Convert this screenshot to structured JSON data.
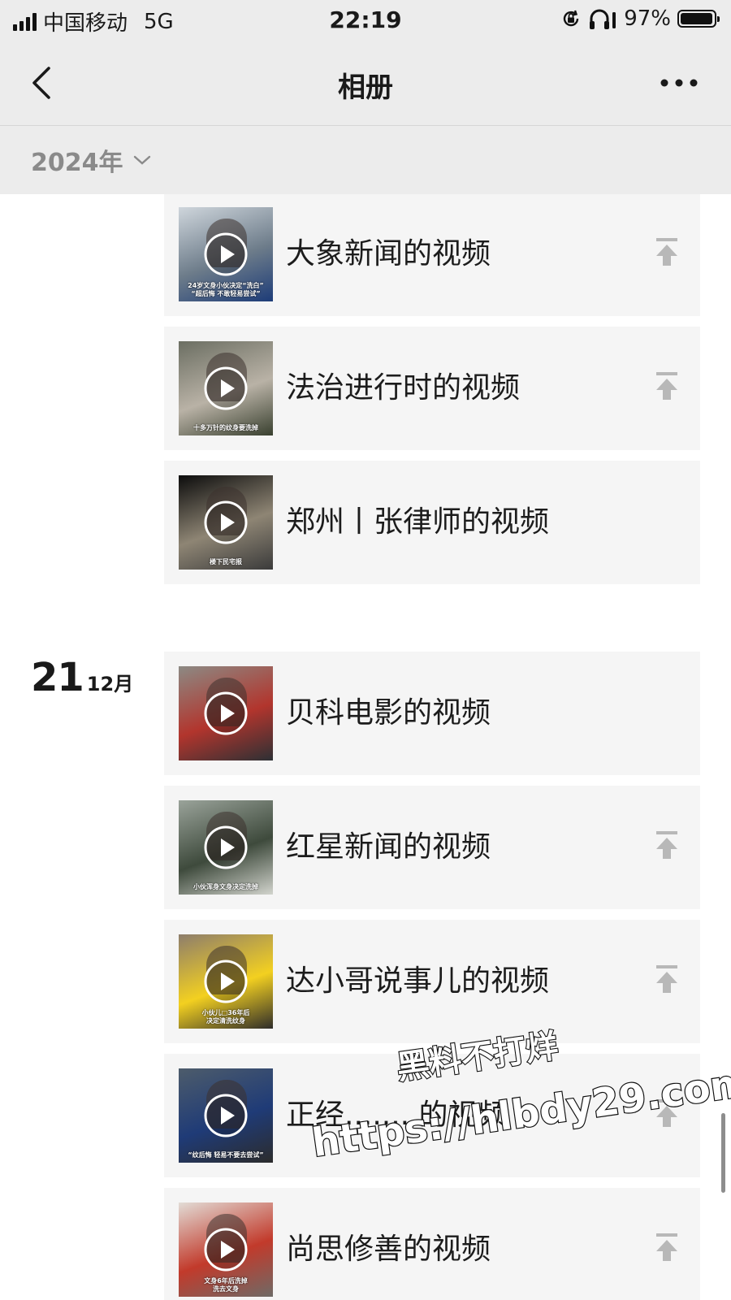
{
  "status_bar": {
    "carrier": "中国移动",
    "network": "5G",
    "time": "22:19",
    "battery_text": "97%",
    "battery_level": 0.97,
    "icons": [
      "signal-icon",
      "rotation-lock-icon",
      "headphones-icon",
      "battery-icon"
    ]
  },
  "nav": {
    "title": "相册",
    "back_icon": "chevron-left-icon",
    "more_icon": "more-icon"
  },
  "year_filter": {
    "label": "2024年",
    "icon": "chevron-down-icon"
  },
  "groups": [
    {
      "day": "",
      "month": "",
      "items": [
        {
          "title": "大象新闻的视频",
          "pinned": true,
          "thumb_caption": "24岁文身小伙决定“洗白”\n“超后悔 不敢轻易尝试”",
          "thumb_colors": [
            "#cfd6dc",
            "#6d7c8a",
            "#1d3c78"
          ]
        },
        {
          "title": "法治进行时的视频",
          "pinned": true,
          "thumb_caption": "十多万针的纹身要洗掉",
          "thumb_colors": [
            "#6b6e62",
            "#b9b2a6",
            "#39402f"
          ]
        },
        {
          "title": "郑州丨张律师的视频",
          "pinned": false,
          "thumb_caption": "楼下民宅报",
          "thumb_colors": [
            "#0c0c0c",
            "#8e8574",
            "#3b3b3b"
          ]
        }
      ]
    },
    {
      "day": "21",
      "month": "12月",
      "items": [
        {
          "title": "贝科电影的视频",
          "pinned": false,
          "thumb_caption": "",
          "thumb_colors": [
            "#8c8a84",
            "#b2352d",
            "#2d3034"
          ]
        },
        {
          "title": "红星新闻的视频",
          "pinned": true,
          "thumb_caption": "小伙浑身文身决定洗掉",
          "thumb_colors": [
            "#9aa39a",
            "#3e4a3c",
            "#d2d4cd"
          ]
        },
        {
          "title": "达小哥说事儿的视频",
          "pinned": true,
          "thumb_caption": "小伙儿□36年后\n决定清洗纹身",
          "thumb_colors": [
            "#8d7d6c",
            "#f3d020",
            "#2f2d2a"
          ]
        },
        {
          "title": "正经........的视频",
          "pinned": true,
          "thumb_caption": "“纹后悔 轻易不要去尝试”",
          "thumb_colors": [
            "#4d5c6b",
            "#1f3b77",
            "#2c2c2c"
          ]
        },
        {
          "title": "尚思修善的视频",
          "pinned": true,
          "thumb_caption": "文身6年后洗掉\n洗去文身",
          "thumb_colors": [
            "#e2dcd6",
            "#c23a2b",
            "#6e6a66"
          ]
        }
      ]
    }
  ],
  "watermark": {
    "line1": "黑料不打烊",
    "line2": "https://hlbdy29.com"
  },
  "colors": {
    "header_bg": "#ececec",
    "card_bg": "#f5f5f5",
    "text": "#1c1c1c",
    "muted": "#8a8a8a",
    "pin": "#b8b8b8"
  }
}
